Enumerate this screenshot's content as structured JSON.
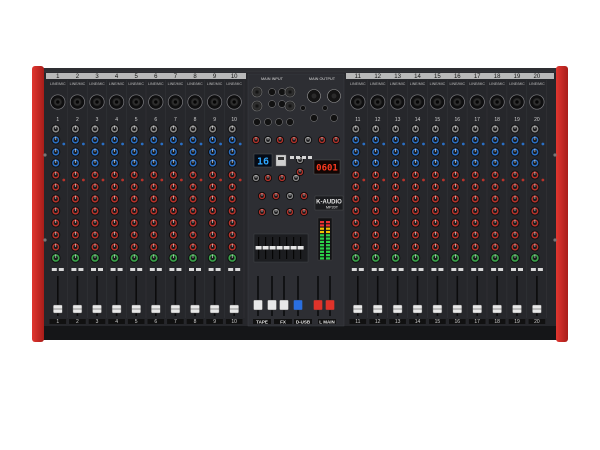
{
  "product": {
    "brand": "K-AUDIO",
    "model": "MP20T"
  },
  "channels": {
    "left": [
      "1",
      "2",
      "3",
      "4",
      "5",
      "6",
      "7",
      "8",
      "9",
      "10"
    ],
    "right": [
      "11",
      "12",
      "13",
      "14",
      "15",
      "16",
      "17",
      "18",
      "19",
      "20"
    ],
    "jack_label": "LINE/MIC"
  },
  "center": {
    "effect_display": "16",
    "player_display": "0601",
    "top_left_label": "MAIN INPUT",
    "top_right_label": "MAIN OUTPUT",
    "bus_labels": [
      "TAPE",
      "FX",
      "D-USB",
      "L MAIN"
    ]
  },
  "colors": {
    "chassis": "#232427",
    "panel": "#2b2c30",
    "side_cap": "#d32a25",
    "knob_blue": "#2a6fc4",
    "knob_red": "#b8322a",
    "knob_green": "#3aa34a",
    "knob_gray": "#8a8a8a",
    "fader_cap": "#e8e8e8",
    "fader_red": "#e0332a",
    "fader_blue": "#2a6fe0"
  }
}
